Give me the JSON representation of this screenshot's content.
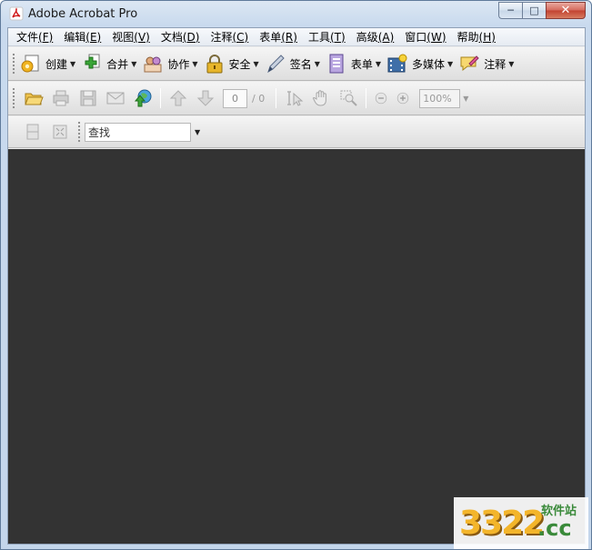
{
  "window": {
    "title": "Adobe Acrobat Pro",
    "controls": {
      "minimize": "─",
      "maximize": "□",
      "close": "✕"
    }
  },
  "menubar": {
    "items": [
      {
        "label": "文件",
        "key": "(F)"
      },
      {
        "label": "编辑",
        "key": "(E)"
      },
      {
        "label": "视图",
        "key": "(V)"
      },
      {
        "label": "文档",
        "key": "(D)"
      },
      {
        "label": "注释",
        "key": "(C)"
      },
      {
        "label": "表单",
        "key": "(R)"
      },
      {
        "label": "工具",
        "key": "(T)"
      },
      {
        "label": "高级",
        "key": "(A)"
      },
      {
        "label": "窗口",
        "key": "(W)"
      },
      {
        "label": "帮助",
        "key": "(H)"
      }
    ]
  },
  "tasks_toolbar": {
    "items": [
      {
        "label": "创建",
        "icon": "create-pdf-icon"
      },
      {
        "label": "合并",
        "icon": "combine-files-icon"
      },
      {
        "label": "协作",
        "icon": "collaborate-icon"
      },
      {
        "label": "安全",
        "icon": "lock-icon"
      },
      {
        "label": "签名",
        "icon": "pen-icon"
      },
      {
        "label": "表单",
        "icon": "form-icon"
      },
      {
        "label": "多媒体",
        "icon": "multimedia-icon"
      },
      {
        "label": "注释",
        "icon": "comment-icon"
      }
    ]
  },
  "file_toolbar": {
    "page_current": "0",
    "page_total": "/ 0",
    "zoom": "100%"
  },
  "find_toolbar": {
    "find_value": "查找"
  },
  "watermark": {
    "digits": "3322",
    "domain": ".cc",
    "site_name": "软件站"
  },
  "colors": {
    "document_background": "#333333",
    "title_gradient": "#c9daee",
    "close_button": "#c2412f"
  }
}
